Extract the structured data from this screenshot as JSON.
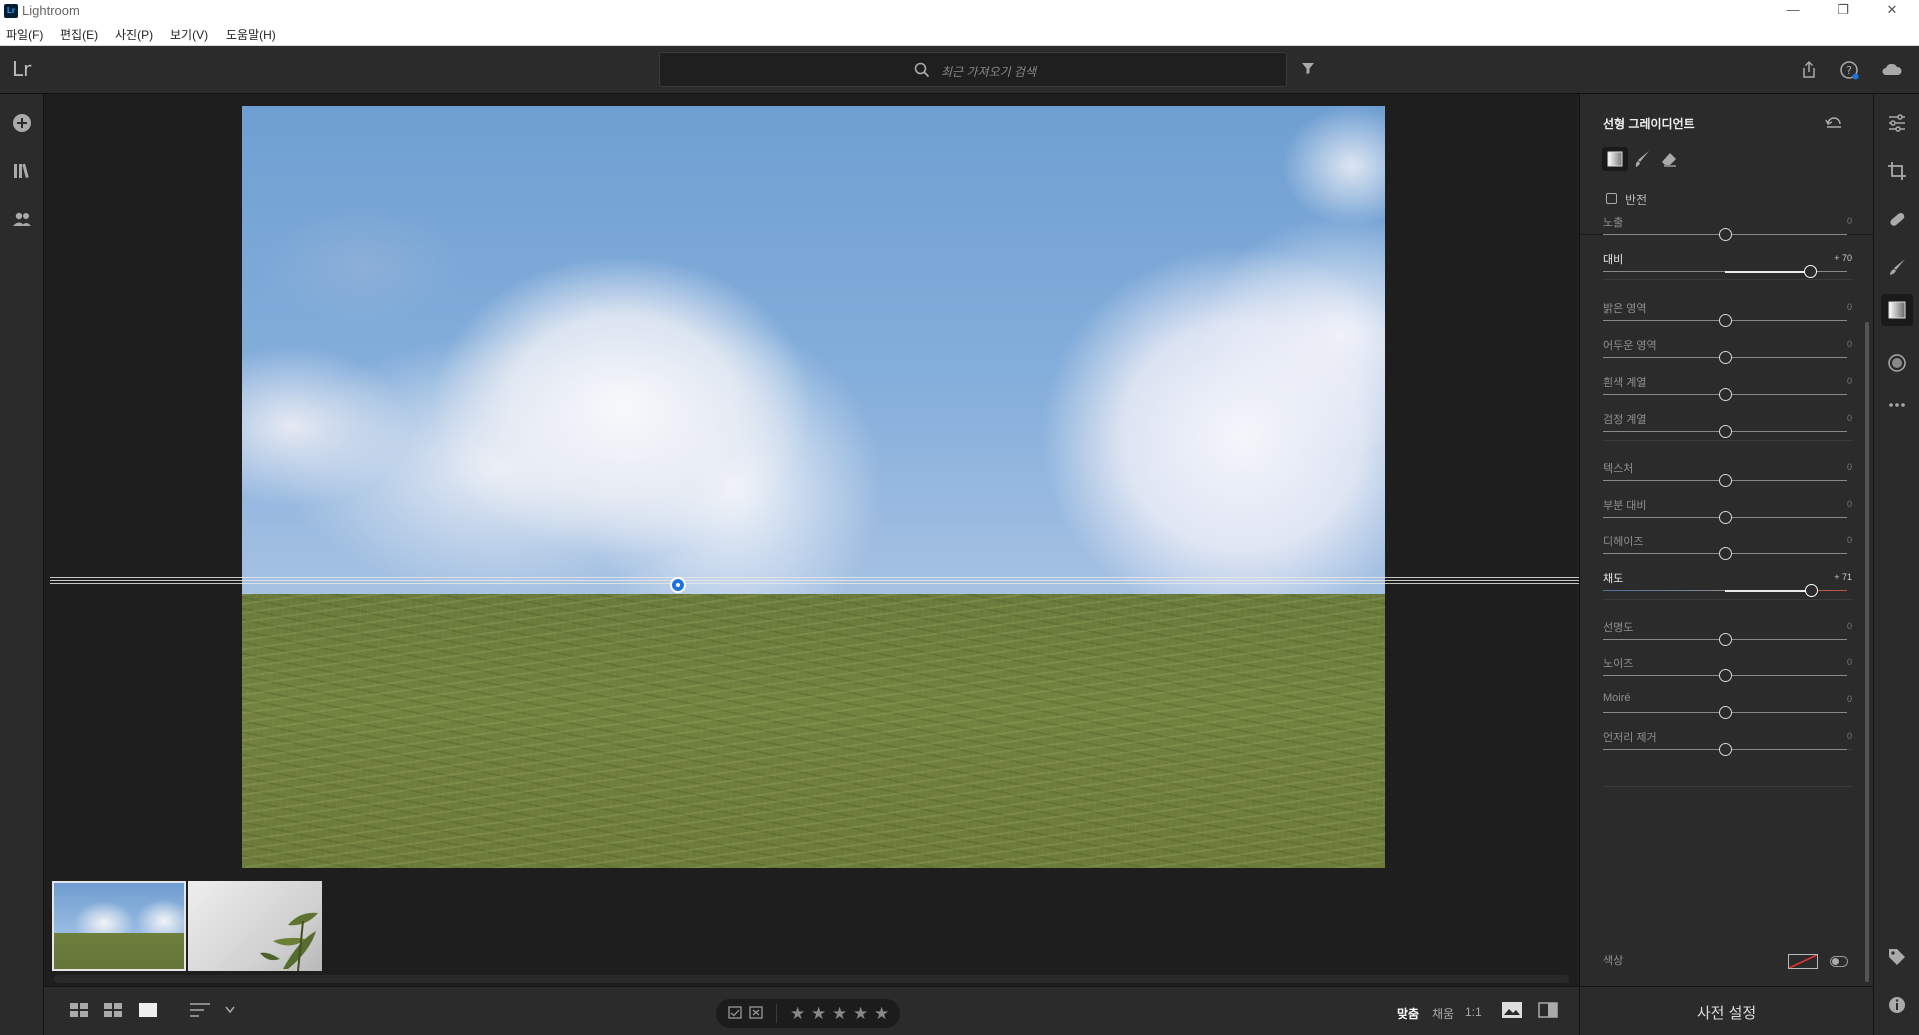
{
  "window": {
    "title": "Lightroom",
    "controls": {
      "minimize": "—",
      "restore": "❐",
      "close": "✕"
    }
  },
  "menu": [
    "파일(F)",
    "편집(E)",
    "사진(P)",
    "보기(V)",
    "도움말(H)"
  ],
  "header": {
    "logo": "Lr",
    "search_placeholder": "최근 가져오기 검색"
  },
  "panel": {
    "title": "선형 그레이디언트",
    "invert_label": "반전",
    "invert_checked": false,
    "sliders": [
      {
        "label": "노출",
        "value": "0",
        "num": 0,
        "active": false
      },
      {
        "label": "대비",
        "value": "+ 70",
        "num": 70,
        "active": true
      },
      {
        "label": "밝은 영역",
        "value": "0",
        "num": 0,
        "active": false
      },
      {
        "label": "어두운 영역",
        "value": "0",
        "num": 0,
        "active": false
      },
      {
        "label": "흰색 계열",
        "value": "0",
        "num": 0,
        "active": false
      },
      {
        "label": "검정 계열",
        "value": "0",
        "num": 0,
        "active": false
      },
      {
        "label": "텍스처",
        "value": "0",
        "num": 0,
        "active": false
      },
      {
        "label": "부분 대비",
        "value": "0",
        "num": 0,
        "active": false
      },
      {
        "label": "디헤이즈",
        "value": "0",
        "num": 0,
        "active": false
      },
      {
        "label": "채도",
        "value": "+ 71",
        "num": 71,
        "active": true
      },
      {
        "label": "선명도",
        "value": "0",
        "num": 0,
        "active": false
      },
      {
        "label": "노이즈",
        "value": "0",
        "num": 0,
        "active": false
      },
      {
        "label": "Moiré",
        "value": "0",
        "num": 0,
        "active": false
      },
      {
        "label": "언저리 제거",
        "value": "0",
        "num": 0,
        "active": false
      }
    ],
    "color_label": "색상",
    "presets_label": "사전 설정"
  },
  "bottom": {
    "zoom_fit": "맞춤",
    "zoom_fill": "채움",
    "zoom_1to1": "1:1",
    "stars": [
      "★",
      "★",
      "★",
      "★",
      "★"
    ]
  },
  "colors": {
    "accent_blue": "#1f73e0",
    "panel_bg": "#2b2b2b",
    "canvas_bg": "#1e1e1e"
  }
}
